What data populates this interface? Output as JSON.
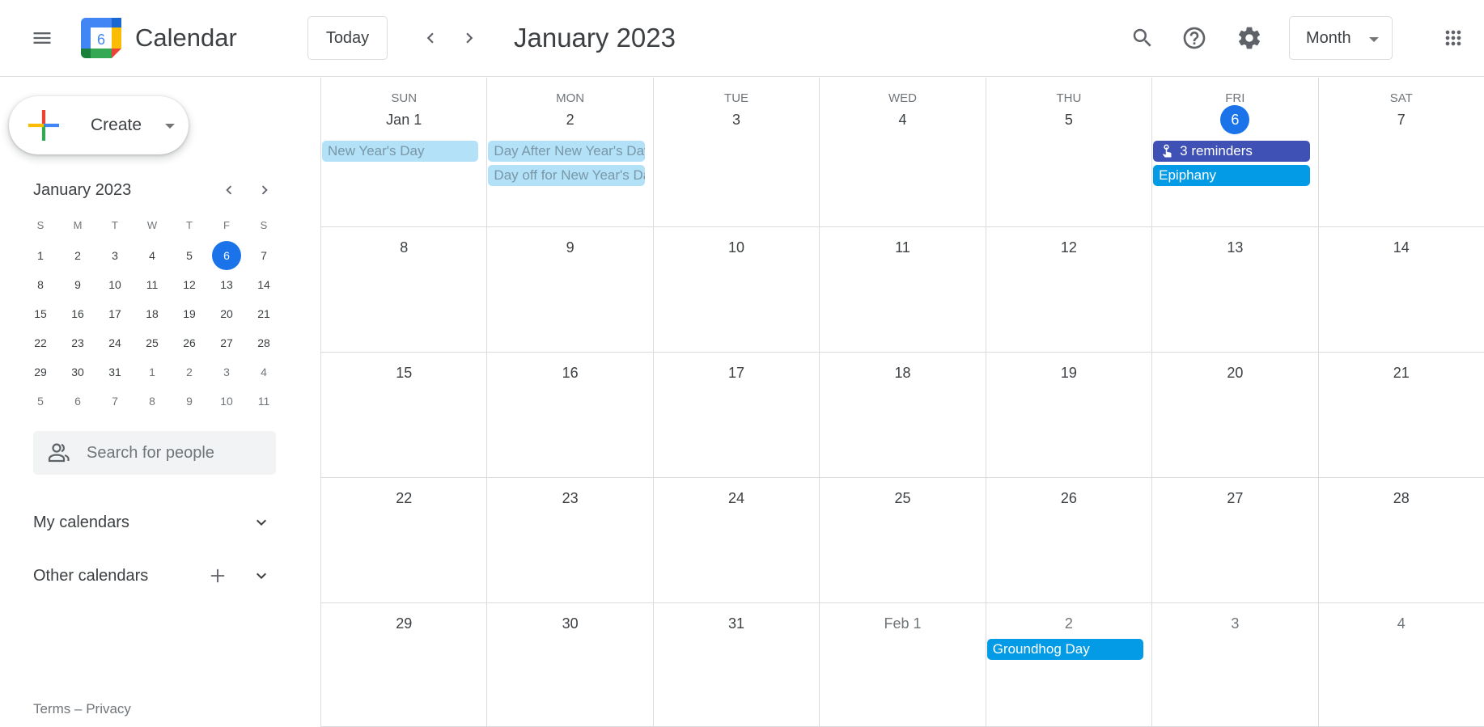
{
  "header": {
    "app_name": "Calendar",
    "logo_day": "6",
    "today_label": "Today",
    "title": "January 2023",
    "view_selected": "Month",
    "icons": {
      "menu": "hamburger-menu-icon",
      "prev": "chevron-left-icon",
      "next": "chevron-right-icon",
      "search": "search-icon",
      "help": "help-circle-icon",
      "settings": "gear-icon",
      "apps": "apps-grid-icon"
    }
  },
  "sidebar": {
    "create_label": "Create",
    "mini_calendar": {
      "title": "January 2023",
      "weekday_letters": [
        "S",
        "M",
        "T",
        "W",
        "T",
        "F",
        "S"
      ],
      "weeks": [
        [
          {
            "d": "1"
          },
          {
            "d": "2"
          },
          {
            "d": "3"
          },
          {
            "d": "4"
          },
          {
            "d": "5"
          },
          {
            "d": "6",
            "today": true
          },
          {
            "d": "7"
          }
        ],
        [
          {
            "d": "8"
          },
          {
            "d": "9"
          },
          {
            "d": "10"
          },
          {
            "d": "11"
          },
          {
            "d": "12"
          },
          {
            "d": "13"
          },
          {
            "d": "14"
          }
        ],
        [
          {
            "d": "15"
          },
          {
            "d": "16"
          },
          {
            "d": "17"
          },
          {
            "d": "18"
          },
          {
            "d": "19"
          },
          {
            "d": "20"
          },
          {
            "d": "21"
          }
        ],
        [
          {
            "d": "22"
          },
          {
            "d": "23"
          },
          {
            "d": "24"
          },
          {
            "d": "25"
          },
          {
            "d": "26"
          },
          {
            "d": "27"
          },
          {
            "d": "28"
          }
        ],
        [
          {
            "d": "29"
          },
          {
            "d": "30"
          },
          {
            "d": "31"
          },
          {
            "d": "1",
            "other": true
          },
          {
            "d": "2",
            "other": true
          },
          {
            "d": "3",
            "other": true
          },
          {
            "d": "4",
            "other": true
          }
        ],
        [
          {
            "d": "5",
            "other": true
          },
          {
            "d": "6",
            "other": true
          },
          {
            "d": "7",
            "other": true
          },
          {
            "d": "8",
            "other": true
          },
          {
            "d": "9",
            "other": true
          },
          {
            "d": "10",
            "other": true
          },
          {
            "d": "11",
            "other": true
          }
        ]
      ]
    },
    "people_search_placeholder": "Search for people",
    "my_calendars_label": "My calendars",
    "other_calendars_label": "Other calendars",
    "footer": {
      "terms": "Terms",
      "separator": " – ",
      "privacy": "Privacy"
    }
  },
  "month_grid": {
    "weekday_headers": [
      "SUN",
      "MON",
      "TUE",
      "WED",
      "THU",
      "FRI",
      "SAT"
    ],
    "weeks": [
      [
        {
          "label": "Jan 1",
          "events": [
            {
              "title": "New Year's Day",
              "style": "faded"
            }
          ]
        },
        {
          "label": "2",
          "events": [
            {
              "title": "Day After New Year's Day",
              "style": "faded"
            },
            {
              "title": "Day off for New Year's Day",
              "style": "faded"
            }
          ]
        },
        {
          "label": "3",
          "events": []
        },
        {
          "label": "4",
          "events": []
        },
        {
          "label": "5",
          "events": []
        },
        {
          "label": "6",
          "today": true,
          "events": [
            {
              "title": "3 reminders",
              "style": "indigo",
              "icon": "reminder-hand-icon"
            },
            {
              "title": "Epiphany",
              "style": "blue"
            }
          ]
        },
        {
          "label": "7",
          "events": []
        }
      ],
      [
        {
          "label": "8",
          "events": []
        },
        {
          "label": "9",
          "events": []
        },
        {
          "label": "10",
          "events": []
        },
        {
          "label": "11",
          "events": []
        },
        {
          "label": "12",
          "events": []
        },
        {
          "label": "13",
          "events": []
        },
        {
          "label": "14",
          "events": []
        }
      ],
      [
        {
          "label": "15",
          "events": []
        },
        {
          "label": "16",
          "events": []
        },
        {
          "label": "17",
          "events": []
        },
        {
          "label": "18",
          "events": []
        },
        {
          "label": "19",
          "events": []
        },
        {
          "label": "20",
          "events": []
        },
        {
          "label": "21",
          "events": []
        }
      ],
      [
        {
          "label": "22",
          "events": []
        },
        {
          "label": "23",
          "events": []
        },
        {
          "label": "24",
          "events": []
        },
        {
          "label": "25",
          "events": []
        },
        {
          "label": "26",
          "events": []
        },
        {
          "label": "27",
          "events": []
        },
        {
          "label": "28",
          "events": []
        }
      ],
      [
        {
          "label": "29",
          "events": []
        },
        {
          "label": "30",
          "events": []
        },
        {
          "label": "31",
          "events": []
        },
        {
          "label": "Feb 1",
          "other": true,
          "events": []
        },
        {
          "label": "2",
          "other": true,
          "events": [
            {
              "title": "Groundhog Day",
              "style": "blue"
            }
          ]
        },
        {
          "label": "3",
          "other": true,
          "events": []
        },
        {
          "label": "4",
          "other": true,
          "events": []
        }
      ]
    ]
  },
  "colors": {
    "accent": "#1a73e8",
    "holiday_chip": "#039be5",
    "holiday_chip_past": "#b3e1f7",
    "reminder_chip": "#3f51b5",
    "grid_line": "#dadce0"
  }
}
